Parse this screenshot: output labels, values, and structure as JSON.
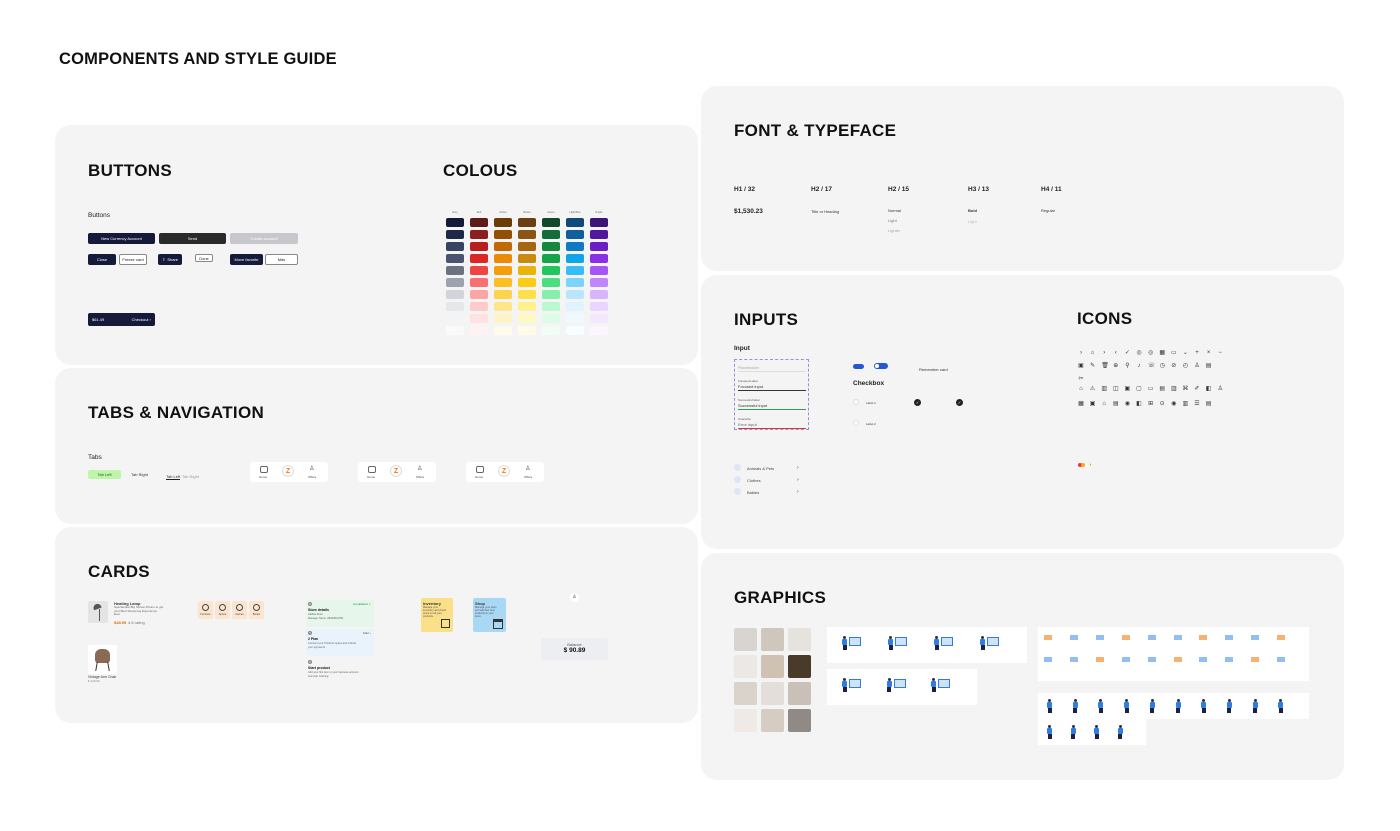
{
  "page_title": "COMPONENTS AND STYLE GUIDE",
  "sections": {
    "buttons": "BUTTONS",
    "colours": "COLOUS",
    "tabs": "TABS & NAVIGATION",
    "cards": "CARDS",
    "font": "FONT & TYPEFACE",
    "inputs": "INPUTS",
    "icons": "ICONS",
    "graphics": "GRAPHICS"
  },
  "buttons": {
    "label": "Buttons",
    "new_currency": "New Currency Account",
    "send": "Send",
    "create_account": "Create account",
    "close": "Close",
    "freeze_card": "Freeze card",
    "share": "Share",
    "done": "Done",
    "move_favorite": "Move favorite",
    "more": "Más",
    "checkout_amount": "$61.49",
    "checkout_label": "Checkout"
  },
  "colours": {
    "columns": [
      "Grey",
      "Red",
      "Amber",
      "Brown",
      "Green",
      "Light Blue",
      "Purple"
    ],
    "palette": [
      [
        "#141a3a",
        "#5e1b1b",
        "#6a3d08",
        "#6b3f12",
        "#0f4a2c",
        "#0d4a7a",
        "#3d1478"
      ],
      [
        "#1f2847",
        "#8b1f1f",
        "#944f07",
        "#8b5413",
        "#146c38",
        "#0f5f9a",
        "#51189e"
      ],
      [
        "#374360",
        "#b71d1d",
        "#c06a06",
        "#a8650f",
        "#17863f",
        "#1179c4",
        "#6a1fc4"
      ],
      [
        "#4a5470",
        "#dc2626",
        "#ea8a07",
        "#c98a10",
        "#16a34a",
        "#0ea5e9",
        "#8b2fe6"
      ],
      [
        "#6b7280",
        "#ef4444",
        "#f59e0b",
        "#eab308",
        "#22c55e",
        "#38bdf8",
        "#a855f7"
      ],
      [
        "#9ca3af",
        "#f87171",
        "#fbbf24",
        "#facc15",
        "#4ade80",
        "#7dd3fc",
        "#c084fc"
      ],
      [
        "#d1d5db",
        "#fca5a5",
        "#fcd34d",
        "#fde047",
        "#86efac",
        "#bae6fd",
        "#d8b4fe"
      ],
      [
        "#e5e7eb",
        "#fecaca",
        "#fde68a",
        "#fef08a",
        "#bbf7d0",
        "#e0f2fe",
        "#e9d5ff"
      ],
      [
        "#f3f4f6",
        "#fee2e2",
        "#fef3c7",
        "#fef9c3",
        "#dcfce7",
        "#f0f9ff",
        "#f3e8ff"
      ],
      [
        "#fafafa",
        "#fef2f2",
        "#fffbeb",
        "#fefce8",
        "#f0fdf4",
        "#f8fdff",
        "#faf5ff"
      ]
    ]
  },
  "tabs": {
    "label": "Tabs",
    "tab_left": "Tab Left",
    "tab_right": "Tab Right",
    "tab_left2": "Tab Left",
    "tab_right2": "Tab Right",
    "nav_items": [
      "Home",
      "Offers"
    ]
  },
  "cards": {
    "product_title": "Heating Lamp",
    "product_desc": "Spectacular Big Screen Phone to get your Best Streaming Experience Ever",
    "product_price": "$48.99",
    "product_rating": "4.8 rating",
    "chair_title": "Vintage Arm Chair",
    "chair_sub": "$ 120.00",
    "categories": [
      "Furniture",
      "Sports",
      "Games",
      "Books"
    ],
    "steps": [
      {
        "num": "1",
        "title": "Store details",
        "status": "Completed",
        "lines": [
          "Adidas Store",
          "Manager Name: 08932831782"
        ]
      },
      {
        "num": "2",
        "title": "2 Plan",
        "status": "Start",
        "lines": [
          "Connect your Products space and include",
          "your payments"
        ]
      },
      {
        "num": "3",
        "title": "Start product",
        "status": "",
        "lines": [
          "Add your first item to your business account",
          "and start ordering"
        ]
      }
    ],
    "yellow_title": "Inventory",
    "yellow_body": "Manage your inventory and check stock on all your products.",
    "blue_title": "Shop",
    "blue_body": "Manage your shop and add few new products to your store.",
    "balance_label": "Balance",
    "balance_value": "$ 90.89"
  },
  "font": {
    "headers": [
      "H1 / 32",
      "H2 / 17",
      "H2 / 15",
      "H3 / 13",
      "H4 / 11"
    ],
    "sample_h1": "$1,530.23",
    "sample_h2": "Title or Heading",
    "weights": [
      "Normal",
      "Light",
      "Lighter"
    ],
    "sample_h3": "Bold",
    "sample_h3b": "Light",
    "sample_h4": "Regular"
  },
  "inputs": {
    "label": "Input",
    "placeholder": "Placeholder",
    "focused_label": "Focused Label",
    "focused_value": "Focused input",
    "success_label": "Successful label",
    "success_value": "Successful input",
    "error_label": "Overwrite",
    "error_value": "Error input",
    "toggle_on": "Toggle",
    "toggle_label": "Remember card",
    "checkbox_title": "Checkbox",
    "checkbox_items": [
      "Label 1",
      "Label 2"
    ],
    "list_items": [
      "Animals & Pets",
      "Clothes",
      "Babies"
    ]
  },
  "icons": {
    "rows": [
      [
        "›",
        "⌂",
        "›",
        "‹",
        "✓",
        "◎",
        "◎",
        "▦",
        "▭",
        "⌄",
        "+",
        "×",
        "−"
      ],
      [
        "▣",
        "✎",
        "🗑",
        "⊕",
        "⚲",
        "♪",
        "☏",
        "◷",
        "⊘",
        "◴",
        "♙",
        "▤"
      ],
      [
        "✂"
      ],
      [
        "⌂",
        "⚠",
        "▥",
        "◫",
        "▣",
        "▢",
        "▭",
        "▤",
        "▥",
        "⌘",
        "✐",
        "◧",
        "♙"
      ],
      [
        "▦",
        "▣",
        "⌂",
        "▤",
        "◉",
        "◧",
        "⊞",
        "⊙",
        "◉",
        "▥",
        "☰",
        "▤"
      ]
    ],
    "colors": [
      "#e53935",
      "#ff9800"
    ]
  },
  "colors": {
    "panel_bg": "#f4f4f4",
    "primary_dark": "#151a3a",
    "accent_blue": "#2f7de1",
    "tab_green": "#bff5a9"
  }
}
